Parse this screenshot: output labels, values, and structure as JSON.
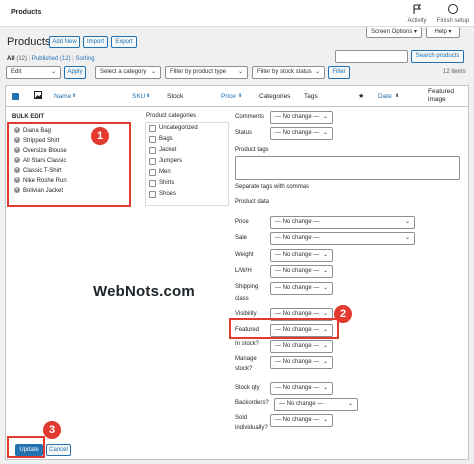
{
  "topbar": {
    "title": "Products",
    "activity_label": "Activity",
    "finish_setup_label": "Finish setup"
  },
  "header": {
    "heading": "Products",
    "add_new": "Add New",
    "import": "Import",
    "export": "Export",
    "screen_options": "Screen Options ▾",
    "help": "Help ▾",
    "search_button": "Search products"
  },
  "views": {
    "all": "All",
    "all_count": "(12)",
    "published": "Published",
    "published_count": "(12)",
    "sorting": "Sorting",
    "sep": "|"
  },
  "filters": {
    "bulk_action": "Edit",
    "apply": "Apply",
    "category": "Select a category",
    "product_type": "Filter by product type",
    "stock_status": "Filter by stock status",
    "filter": "Filter",
    "items_count": "12 items"
  },
  "columns": {
    "name": "Name",
    "sku": "SKU",
    "stock": "Stock",
    "price": "Price",
    "categories": "Categories",
    "tags": "Tags",
    "date": "Date",
    "featured_image": "Featured image"
  },
  "bulk_edit": {
    "title": "BULK EDIT",
    "items": [
      "Diana Bag",
      "Stripped Shirt",
      "Oversize Blouse",
      "All Stars Classic",
      "Classic T-Shirt",
      "Nike Roshe Run",
      "Bolivian Jacket"
    ]
  },
  "categories_panel": {
    "title": "Product categories",
    "items": [
      "Uncategorized",
      "Bags",
      "Jacket",
      "Jumpers",
      "Men",
      "Shirts",
      "Shoes"
    ]
  },
  "right_fields": {
    "comments_label": "Comments",
    "status_label": "Status",
    "no_change": "— No change —",
    "tags_label": "Product tags",
    "tags_hint": "Separate tags with commas",
    "product_data": "Product data",
    "price": "Price",
    "sale": "Sale",
    "weight": "Weight",
    "lwh_label": "L/W/H",
    "shipping_label": "Shipping",
    "class_label": "class",
    "visibility": "Visibility",
    "featured": "Featured",
    "in_stock_label": "In stock?",
    "manage_label": "Manage",
    "stock_q_label": "stock?",
    "stock_qty": "Stock qty",
    "backorders": "Backorders?",
    "sold_label": "Sold",
    "individually_label": "individually?"
  },
  "footer_buttons": {
    "update": "Update",
    "cancel": "Cancel"
  },
  "annotations": {
    "one": "1",
    "two": "2",
    "three": "3"
  },
  "watermark": "WebNots.com",
  "colors": {
    "accent": "#2271b1",
    "annotation": "#e23a2e"
  }
}
